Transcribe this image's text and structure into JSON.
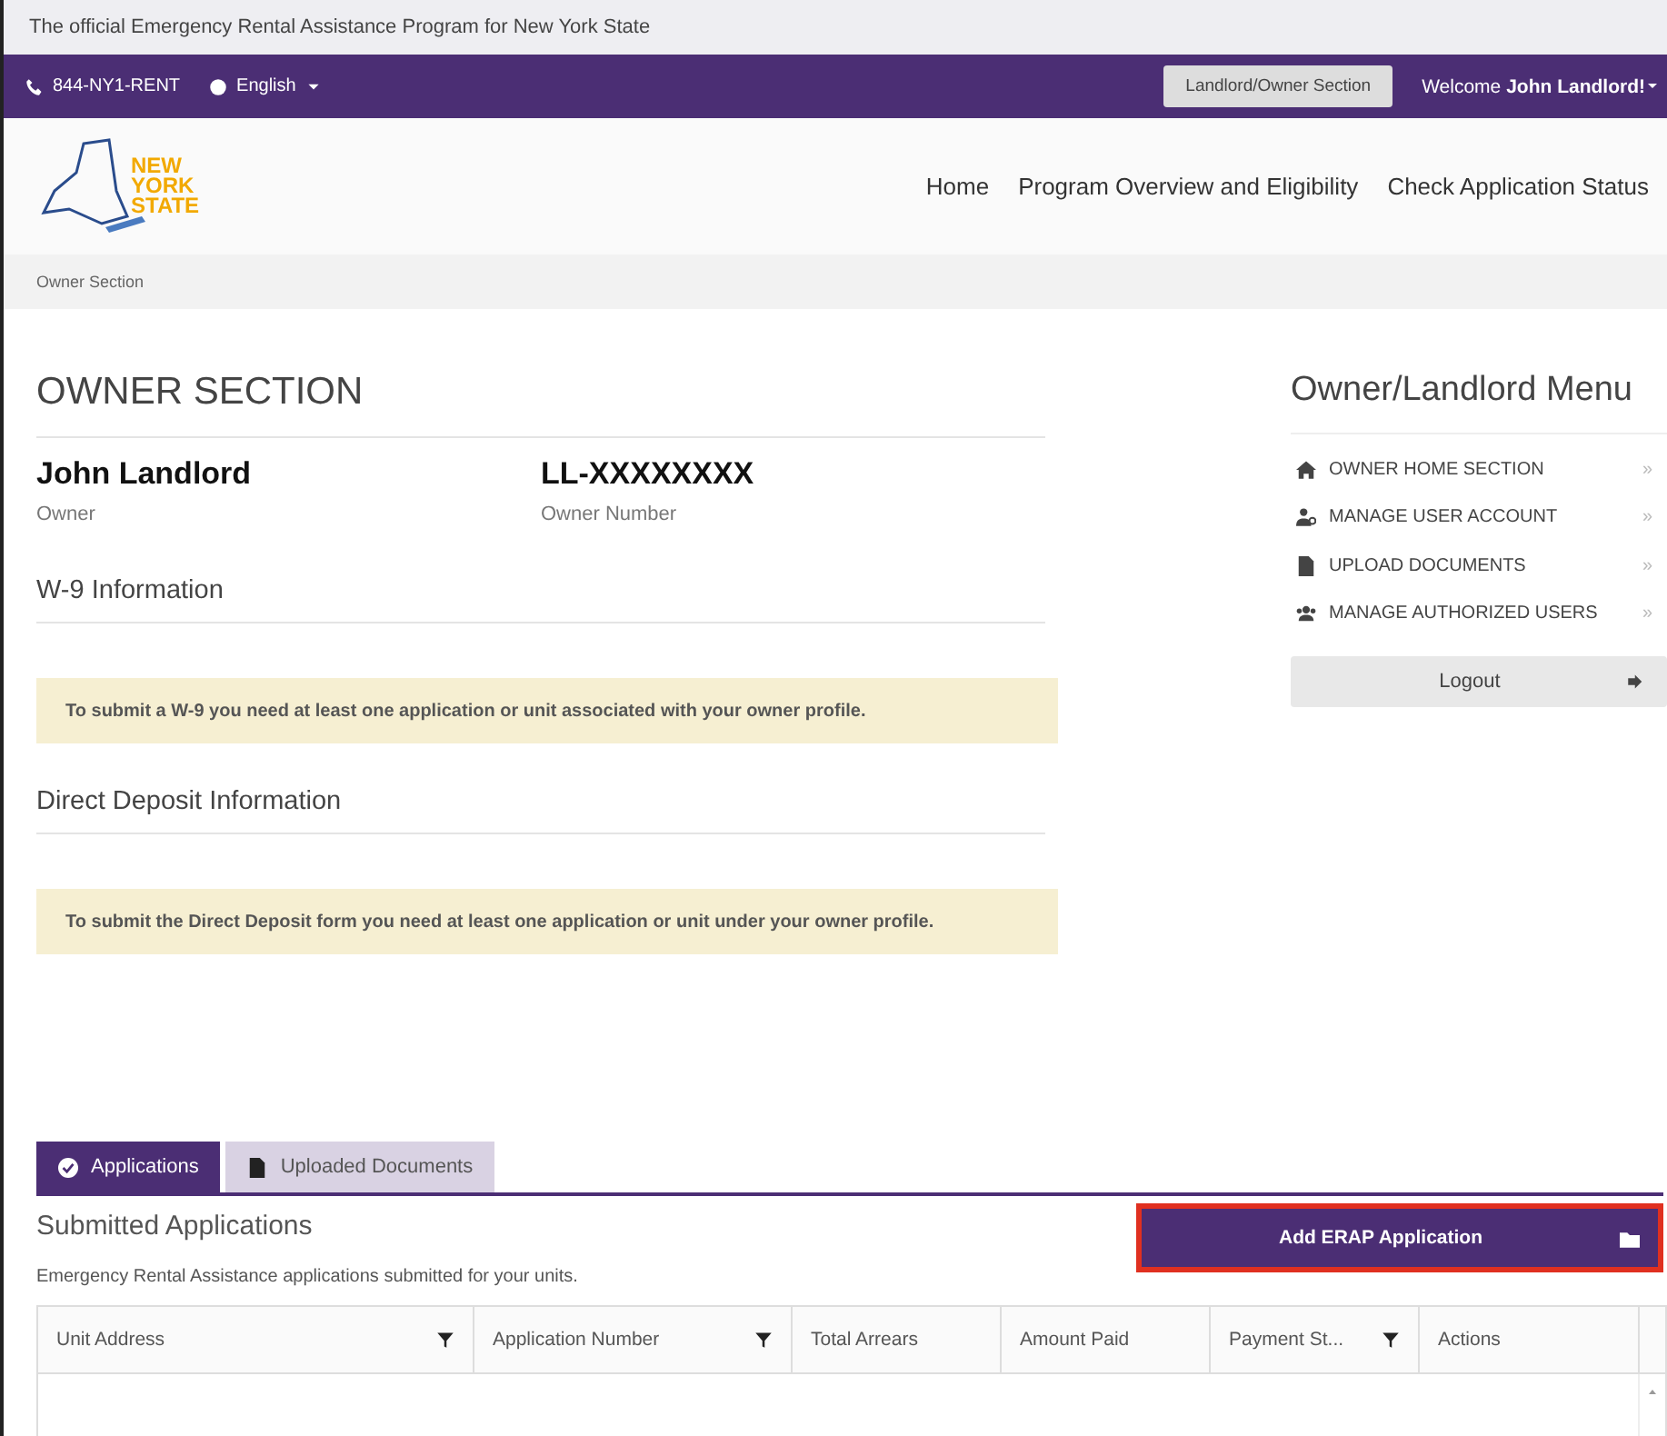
{
  "top_notice": "The official Emergency Rental Assistance Program for New York State",
  "utility_bar": {
    "phone": "844-NY1-RENT",
    "language": "English",
    "section_button": "Landlord/Owner Section",
    "welcome": "Welcome **John Landlord!**"
  },
  "logo": {
    "lines": [
      "NEW",
      "YORK",
      "STATE"
    ]
  },
  "nav": [
    "Home",
    "Program Overview and Eligibility",
    "Check Application Status"
  ],
  "breadcrumb": "Owner Section",
  "page_title": "OWNER SECTION",
  "owner": {
    "name": "John Landlord",
    "name_label": "Owner",
    "number": "LL-XXXXXXXX",
    "number_label": "Owner Number"
  },
  "sections": [
    {
      "heading": "W-9 Information",
      "notice": "To submit a W-9 you need at least one application or unit associated with your owner profile."
    },
    {
      "heading": "Direct Deposit Information",
      "notice": "To submit the Direct Deposit form you need at least one application or unit under your owner profile."
    }
  ],
  "menu": {
    "title": "Owner/Landlord Menu",
    "items": [
      {
        "label": "OWNER HOME SECTION",
        "chevron": "»"
      },
      {
        "label": "MANAGE USER ACCOUNT",
        "chevron": "»"
      },
      {
        "label": "UPLOAD DOCUMENTS",
        "chevron": "»"
      },
      {
        "label": "MANAGE AUTHORIZED USERS",
        "chevron": "»"
      }
    ],
    "logout": "Logout"
  },
  "tabs": [
    {
      "label": "Applications",
      "selected": true
    },
    {
      "label": "Uploaded Documents",
      "selected": false
    }
  ],
  "applications": {
    "title": "Submitted Applications",
    "subtitle": "Emergency Rental Assistance applications submitted for your units.",
    "add_button": {
      "label": "Add ERAP Application",
      "highlighted": true
    }
  },
  "table": {
    "columns": [
      {
        "label": "Unit Address",
        "filterable": true
      },
      {
        "label": "Application Number",
        "filterable": true
      },
      {
        "label": "Total Arrears",
        "filterable": false
      },
      {
        "label": "Amount Paid",
        "filterable": false
      },
      {
        "label": "Payment St...",
        "filterable": true
      },
      {
        "label": "Actions",
        "filterable": false
      }
    ]
  }
}
